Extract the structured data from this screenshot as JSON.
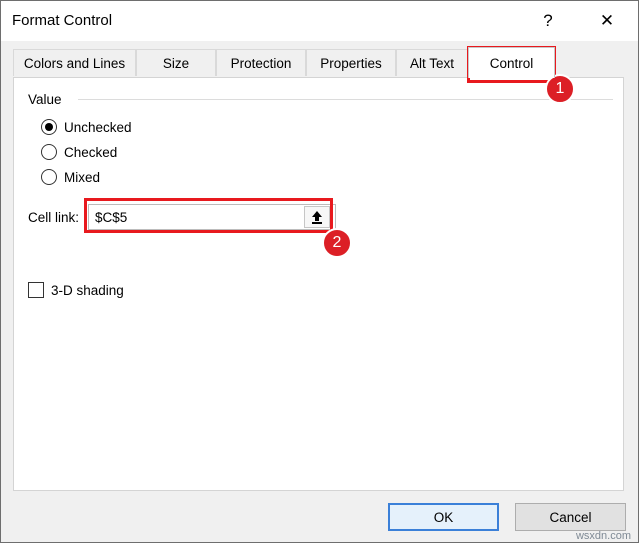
{
  "window": {
    "title": "Format Control",
    "help_label": "?",
    "close_label": "✕"
  },
  "tabs": [
    {
      "label": "Colors and Lines"
    },
    {
      "label": "Size"
    },
    {
      "label": "Protection"
    },
    {
      "label": "Properties"
    },
    {
      "label": "Alt Text"
    },
    {
      "label": "Control",
      "active": true
    }
  ],
  "control_tab": {
    "group_label": "Value",
    "radios": [
      {
        "label": "Unchecked",
        "selected": true
      },
      {
        "label": "Checked",
        "selected": false
      },
      {
        "label": "Mixed",
        "selected": false
      }
    ],
    "cell_link_label": "Cell link:",
    "cell_link_value": "$C$5",
    "shading_label": "3-D shading",
    "shading_checked": false
  },
  "annotations": {
    "badge_1": "1",
    "badge_2": "2",
    "highlight_color": "#e8191e"
  },
  "footer": {
    "ok_label": "OK",
    "cancel_label": "Cancel"
  },
  "watermark": "wsxdn.com"
}
